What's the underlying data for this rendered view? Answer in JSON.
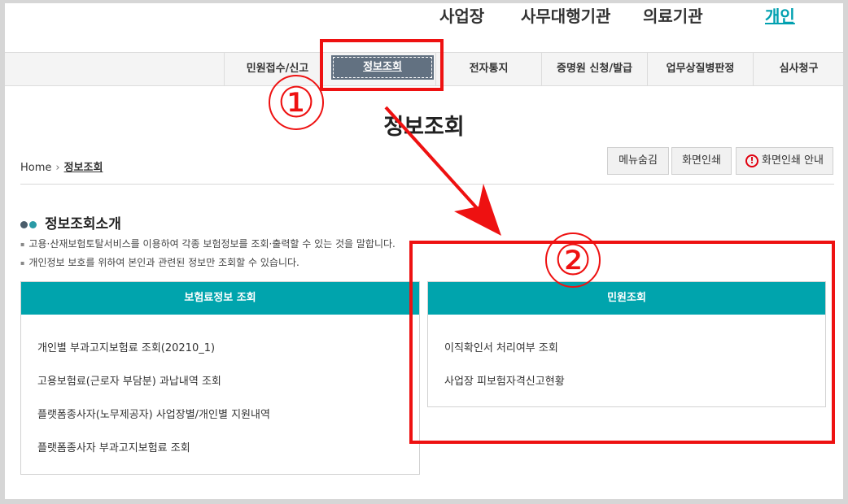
{
  "topnav": {
    "items": [
      "사업장",
      "사무대행기관",
      "의료기관"
    ],
    "active": "개인"
  },
  "menu": {
    "items": [
      "민원접수/신고",
      "정보조회",
      "전자통지",
      "증명원 신청/발급",
      "업무상질병판정",
      "심사청구"
    ]
  },
  "page": {
    "title": "정보조회"
  },
  "breadcrumb": {
    "home": "Home",
    "current": "정보조회"
  },
  "utility": {
    "hide_menu": "메뉴숨김",
    "print": "화면인쇄",
    "print_guide": "화면인쇄 안내",
    "warn_glyph": "!"
  },
  "intro": {
    "title": "정보조회소개",
    "lines": [
      "고용·산재보험토탈서비스를 이용하여 각종 보험정보를 조회·출력할 수 있는 것을 말합니다.",
      "개인정보 보호를 위하여 본인과 관련된 정보만 조회할 수 있습니다."
    ]
  },
  "card_insurance": {
    "title": "보험료정보 조회",
    "links": [
      "개인별 부과고지보험료 조회(20210_1)",
      "고용보험료(근로자 부담분) 과납내역 조회",
      "플랫폼종사자(노무제공자) 사업장별/개인별 지원내역",
      "플랫폼종사자 부과고지보험료 조회"
    ]
  },
  "card_civil": {
    "title": "민원조회",
    "links": [
      "이직확인서 처리여부 조회",
      "사업장 피보험자격신고현황"
    ]
  },
  "annotations": {
    "one": "①",
    "two": "②"
  },
  "colors": {
    "accent": "#00a4ad",
    "active_menu": "#627181",
    "annotation": "#ee1111",
    "dot_dark": "#4b5d6b",
    "dot_teal": "#2a9aa6"
  }
}
